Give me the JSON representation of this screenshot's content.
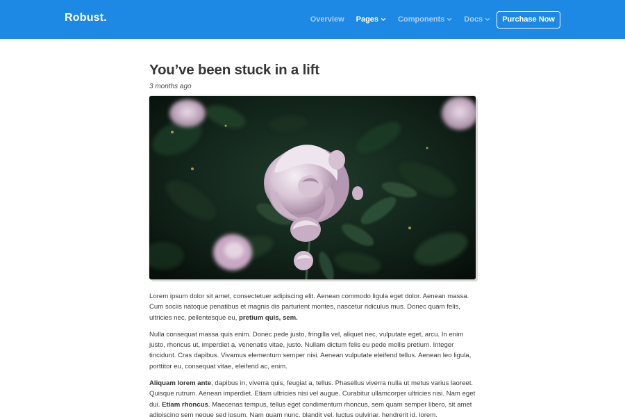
{
  "navbar": {
    "brand": "Robust.",
    "items": [
      {
        "label": "Overview",
        "has_dropdown": false,
        "active": false
      },
      {
        "label": "Pages",
        "has_dropdown": true,
        "active": true
      },
      {
        "label": "Components",
        "has_dropdown": true,
        "active": false
      },
      {
        "label": "Docs",
        "has_dropdown": true,
        "active": false
      }
    ],
    "purchase_label": "Purchase Now",
    "icons": {
      "dropdown": "chevron-down-icon"
    }
  },
  "article": {
    "title": "You’ve been stuck in a lift",
    "meta": "3 months ago",
    "hero_image": "photo of pale pink roses against dark green foliage",
    "paragraphs": [
      {
        "runs": [
          {
            "text": "Lorem ipsum dolor sit amet, consectetuer adipiscing elit. Aenean commodo ligula eget dolor. Aenean massa. Cum sociis natoque penatibus et magnis dis parturient montes, nascetur ridiculus mus. Donec quam felis, ultricies nec, pellentesque eu, ",
            "bold": false
          },
          {
            "text": "pretium quis, sem.",
            "bold": true
          }
        ]
      },
      {
        "runs": [
          {
            "text": "Nulla consequat massa quis enim. Donec pede justo, fringilla vel, aliquet nec, vulputate eget, arcu. In enim justo, rhoncus ut, imperdiet a, venenatis vitae, justo. Nullam dictum felis eu pede mollis pretium. Integer tincidunt. Cras dapibus. Vivamus elementum semper nisi. Aenean vulputate eleifend tellus. Aenean leo ligula, porttitor eu, consequat vitae, eleifend ac, enim.",
            "bold": false
          }
        ]
      },
      {
        "runs": [
          {
            "text": "Aliquam lorem ante",
            "bold": true
          },
          {
            "text": ", dapibus in, viverra quis, feugiat a, tellus. Phasellus viverra nulla ut metus varius laoreet. Quisque rutrum. Aenean imperdiet. Etiam ultricies nisi vel augue. Curabitur ullamcorper ultricies nisi. Nam eget dui. ",
            "bold": false
          },
          {
            "text": "Etiam rhoncus",
            "bold": true
          },
          {
            "text": ". Maecenas tempus, tellus eget condimentum rhoncus, sem quam semper libero, sit amet adipiscing sem neque sed ipsum. Nam quam nunc, blandit vel, luctus pulvinar, hendrerit id, lorem.",
            "bold": false
          }
        ]
      }
    ]
  },
  "colors": {
    "navbar_bg": "#1e88e5",
    "nav_text_muted": "#a9cdf3",
    "nav_text_active": "#ffffff",
    "title": "#363636",
    "body_text": "#3a3a3a"
  }
}
